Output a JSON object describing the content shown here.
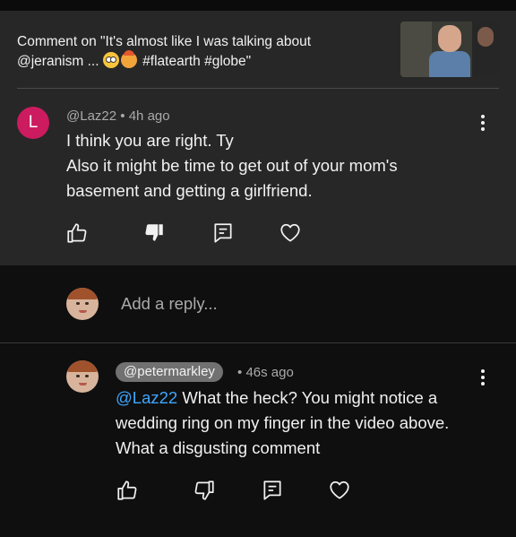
{
  "context": {
    "prefix": "Comment on \"It's almost like I was talking about",
    "line2_start": "@jeranism ...",
    "hashtags": "#flatearth #globe\"",
    "emojis": [
      "flushed-face-emoji",
      "exploding-head-emoji"
    ]
  },
  "comment": {
    "avatar_letter": "L",
    "author": "@Laz22",
    "separator": "•",
    "time": "4h ago",
    "text_line1": "I think you are right. Ty",
    "text_line2": "Also it might be time to get out of your mom's",
    "text_line3": "basement and getting a girlfriend."
  },
  "reply_box": {
    "placeholder": "Add a reply..."
  },
  "reply": {
    "author": "@petermarkley",
    "separator": "•",
    "time": "46s ago",
    "mention": "@Laz22",
    "text_line1_rest": " What the heck? You might notice a",
    "text_line2": "wedding ring on my finger in the video above.",
    "text_line3": "What a disgusting comment"
  },
  "icons": [
    "like-icon",
    "dislike-icon",
    "reply-icon",
    "heart-icon",
    "more-icon"
  ],
  "colors": {
    "avatar_l": "#cc1b5f",
    "mention": "#3ea6ff",
    "panel": "#272727",
    "background": "#0f0f0f"
  }
}
